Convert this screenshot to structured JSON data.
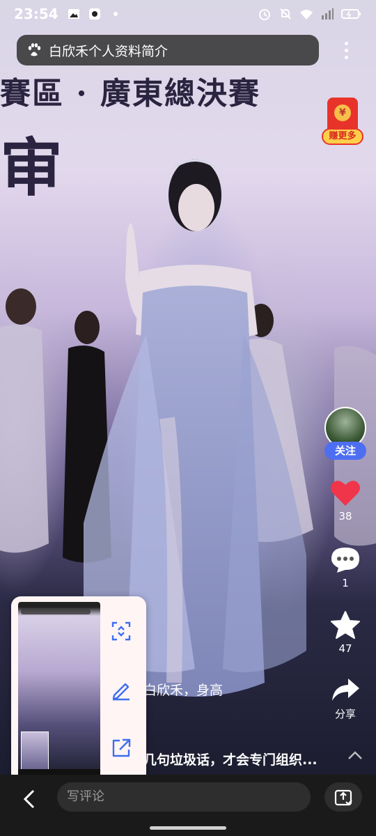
{
  "status_bar": {
    "time": "23:54",
    "icons": [
      "image-icon",
      "app-icon",
      "dot-icon",
      "alarm-icon",
      "mute-icon",
      "wifi-icon",
      "signal-icon",
      "battery-icon"
    ]
  },
  "search": {
    "query": "白欣禾个人资料简介",
    "icon": "baidu-paw-icon"
  },
  "video": {
    "banner_line_1": "賽區 · 廣東總決賽",
    "banner_line_2": "审"
  },
  "red_packet": {
    "coin_symbol": "¥",
    "label": "赚更多"
  },
  "side_rail": {
    "follow_label": "关注",
    "like_count": "38",
    "comment_count": "1",
    "favorite_count": "47",
    "share_label": "分享",
    "like_color": "#f0344a"
  },
  "caption": {
    "line_1": "白欣禾，身高",
    "line_2": "几句垃圾话，才会专门组织..."
  },
  "bottom_bar": {
    "comment_placeholder": "写评论"
  },
  "colors": {
    "accent_blue": "#4e6ef2",
    "float_icon_blue": "#3d6ef0"
  }
}
